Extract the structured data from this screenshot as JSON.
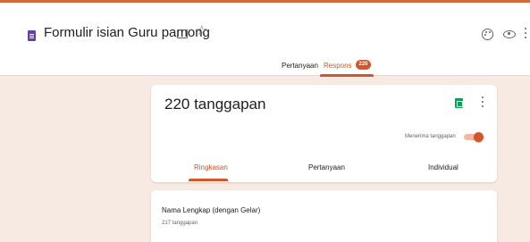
{
  "header": {
    "form_title": "Formulir isian Guru pamong",
    "icons": [
      "form-doc-icon",
      "folder-icon",
      "star-icon",
      "palette-icon",
      "eye-icon",
      "more-vert-icon"
    ],
    "star_glyph": "☆",
    "tabs": [
      {
        "label": "Pertanyaan"
      },
      {
        "label": "Respons",
        "badge": "220",
        "active": true
      }
    ]
  },
  "summary_card": {
    "response_count_text": "220 tanggapan",
    "accepting_label": "Menerima tanggapan",
    "accepting_on": true,
    "icons": [
      "sheets-icon",
      "more-vert-icon"
    ],
    "sub_tabs": [
      {
        "label": "Ringkasan",
        "active": true
      },
      {
        "label": "Pertanyaan"
      },
      {
        "label": "Individual"
      }
    ]
  },
  "question_card": {
    "title": "Nama Lengkap (dengan Gelar)",
    "response_count": "217 tanggapan"
  },
  "colors": {
    "accent": "#d3562a",
    "background": "#f6eae3",
    "form_icon": "#673ab7",
    "sheets_icon": "#0f9d58"
  }
}
